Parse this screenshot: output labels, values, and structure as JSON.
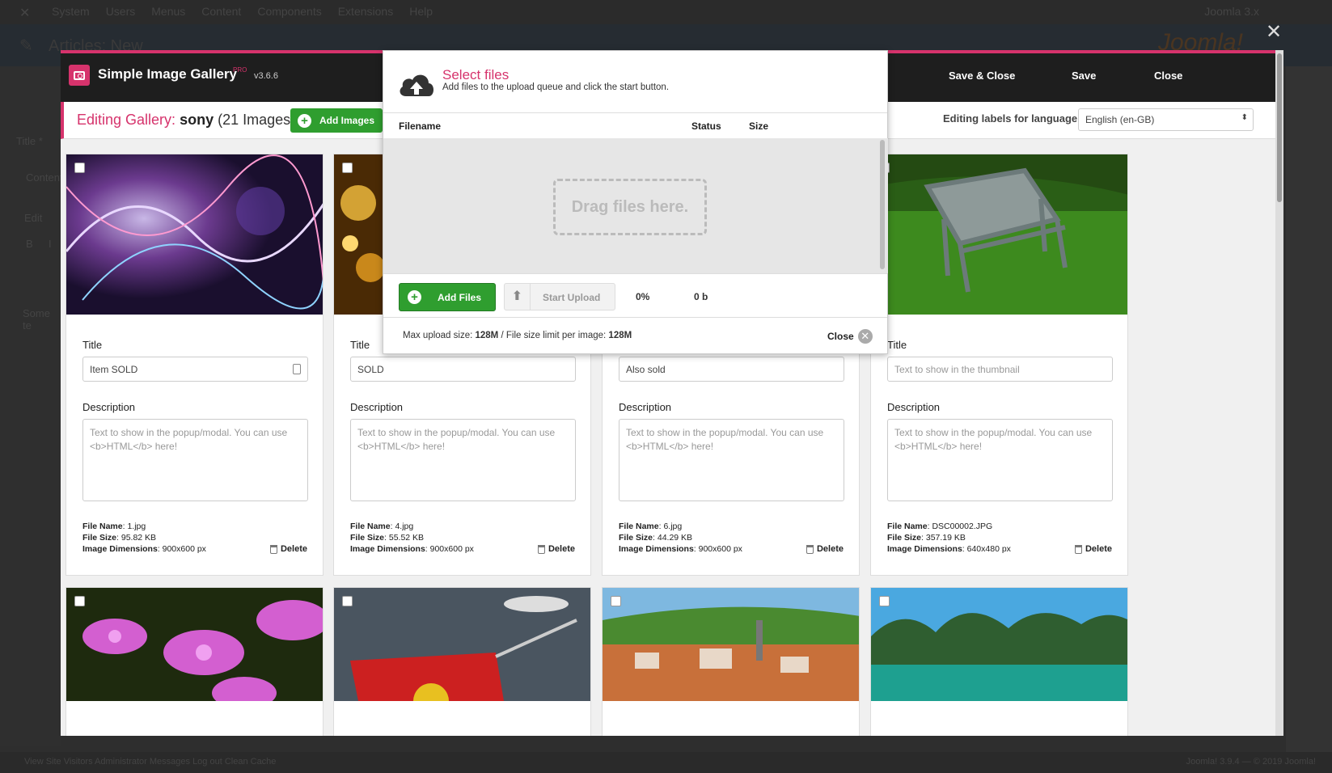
{
  "background": {
    "menu": [
      "System",
      "Users",
      "Menus",
      "Content",
      "Components",
      "Extensions",
      "Help"
    ],
    "site_name": "Joomla 3.x",
    "page_title": "Articles: New",
    "brand": "Joomla!",
    "left_labels": [
      "Title *",
      "Content",
      "Edit",
      "B",
      "I",
      "Some te"
    ],
    "footer": "View Site   Visitors   Administrator   Messages   Log out   Clean Cache",
    "footer_right": "Joomla! 3.9.4 — © 2019 Joomla!"
  },
  "app": {
    "title": "Simple Image Gallery",
    "pro": "PRO",
    "version": "v3.6.6"
  },
  "toolbar": {
    "save_close": "Save & Close",
    "save": "Save",
    "close": "Close"
  },
  "editing": {
    "prefix": "Editing Gallery:",
    "gallery": "sony",
    "count": "(21 Images)",
    "add_images": "Add Images"
  },
  "language": {
    "label": "Editing labels for language",
    "selected": "English (en-GB)"
  },
  "labels": {
    "title": "Title",
    "description": "Description",
    "file_name": "File Name",
    "file_size": "File Size",
    "dimensions": "Image Dimensions",
    "delete": "Delete"
  },
  "placeholders": {
    "title": "Text to show in the thumbnail",
    "description": "Text to show in the popup/modal. You can use <b>HTML</b> here!"
  },
  "cards": [
    {
      "title": "Item SOLD",
      "file_name": "1.jpg",
      "file_size": "95.82 KB",
      "dimensions": "900x600 px",
      "art": "abstract"
    },
    {
      "title": "SOLD",
      "file_name": "4.jpg",
      "file_size": "55.52 KB",
      "dimensions": "900x600 px",
      "art": "bokeh"
    },
    {
      "title": "Also sold",
      "file_name": "6.jpg",
      "file_size": "44.29 KB",
      "dimensions": "900x600 px",
      "art": "hidden"
    },
    {
      "title": "",
      "file_name": "DSC00002.JPG",
      "file_size": "357.19 KB",
      "dimensions": "640x480 px",
      "art": "chair"
    }
  ],
  "row2": [
    {
      "art": "orchid"
    },
    {
      "art": "cart"
    },
    {
      "art": "town"
    },
    {
      "art": "bay"
    }
  ],
  "upload": {
    "title": "Select files",
    "subtitle": "Add files to the upload queue and click the start button.",
    "col_filename": "Filename",
    "col_status": "Status",
    "col_size": "Size",
    "drop_text": "Drag files here.",
    "add_files": "Add Files",
    "start_upload": "Start Upload",
    "percent": "0%",
    "bytes": "0 b",
    "max_label": "Max upload size:",
    "max_value": "128M",
    "limit_label": "/ File size limit per image:",
    "limit_value": "128M",
    "close": "Close"
  },
  "colors": {
    "accent": "#d6336c",
    "green": "#2f9e2f",
    "toolbar": "#1e1e1e"
  }
}
